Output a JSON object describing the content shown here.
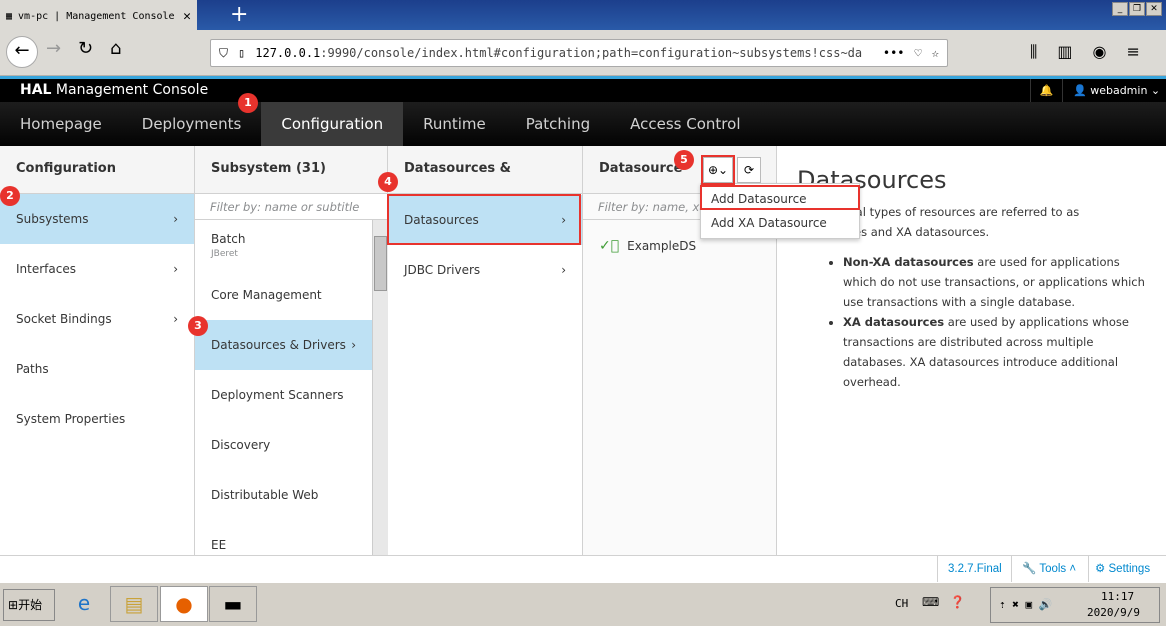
{
  "browser": {
    "tab_title": "vm-pc | Management Console",
    "url_host": "127.0.0.1",
    "url_rest": ":9990/console/index.html#configuration;path=configuration~subsystems!css~da"
  },
  "header": {
    "brand_bold": "HAL",
    "brand_rest": " Management Console",
    "user": "webadmin"
  },
  "nav": [
    "Homepage",
    "Deployments",
    "Configuration",
    "Runtime",
    "Patching",
    "Access Control"
  ],
  "badges": [
    "1",
    "2",
    "3",
    "4",
    "5"
  ],
  "col1": {
    "title": "Configuration",
    "items": [
      "Subsystems",
      "Interfaces",
      "Socket Bindings",
      "Paths",
      "System Properties"
    ]
  },
  "col2": {
    "title": "Subsystem (31)",
    "filter": "Filter by: name or subtitle",
    "items": [
      {
        "label": "Batch",
        "sub": "JBeret"
      },
      {
        "label": "Core Management"
      },
      {
        "label": "Datasources & Drivers"
      },
      {
        "label": "Deployment Scanners"
      },
      {
        "label": "Discovery"
      },
      {
        "label": "Distributable Web"
      },
      {
        "label": "EE"
      }
    ]
  },
  "col3": {
    "title": "Datasources & Drivers",
    "items": [
      "Datasources",
      "JDBC Drivers"
    ]
  },
  "col4": {
    "title": "Datasource",
    "filter": "Filter by: name, xa,",
    "items": [
      "ExampleDS"
    ]
  },
  "menu": [
    "Add Datasource",
    "Add XA Datasource"
  ],
  "content": {
    "title": "Datasources",
    "intro": "Two general types of resources are referred to as datasources and XA datasources.",
    "b1_bold": "Non-XA datasources",
    "b1": " are used for applications which do not use transactions, or applications which use transactions with a single database.",
    "b2_bold": "XA datasources",
    "b2": " are used by applications whose transactions are distributed across multiple databases. XA datasources introduce additional overhead."
  },
  "footer": {
    "version": "3.2.7.Final",
    "tools": "Tools",
    "settings": "Settings"
  },
  "taskbar": {
    "start": "开始",
    "lang": "CH",
    "time": "11:17",
    "date": "2020/9/9"
  },
  "colors": {
    "accent": "#0088ce",
    "selected": "#bee1f4",
    "badge": "#e8332d",
    "ok": "#3f9c35"
  }
}
